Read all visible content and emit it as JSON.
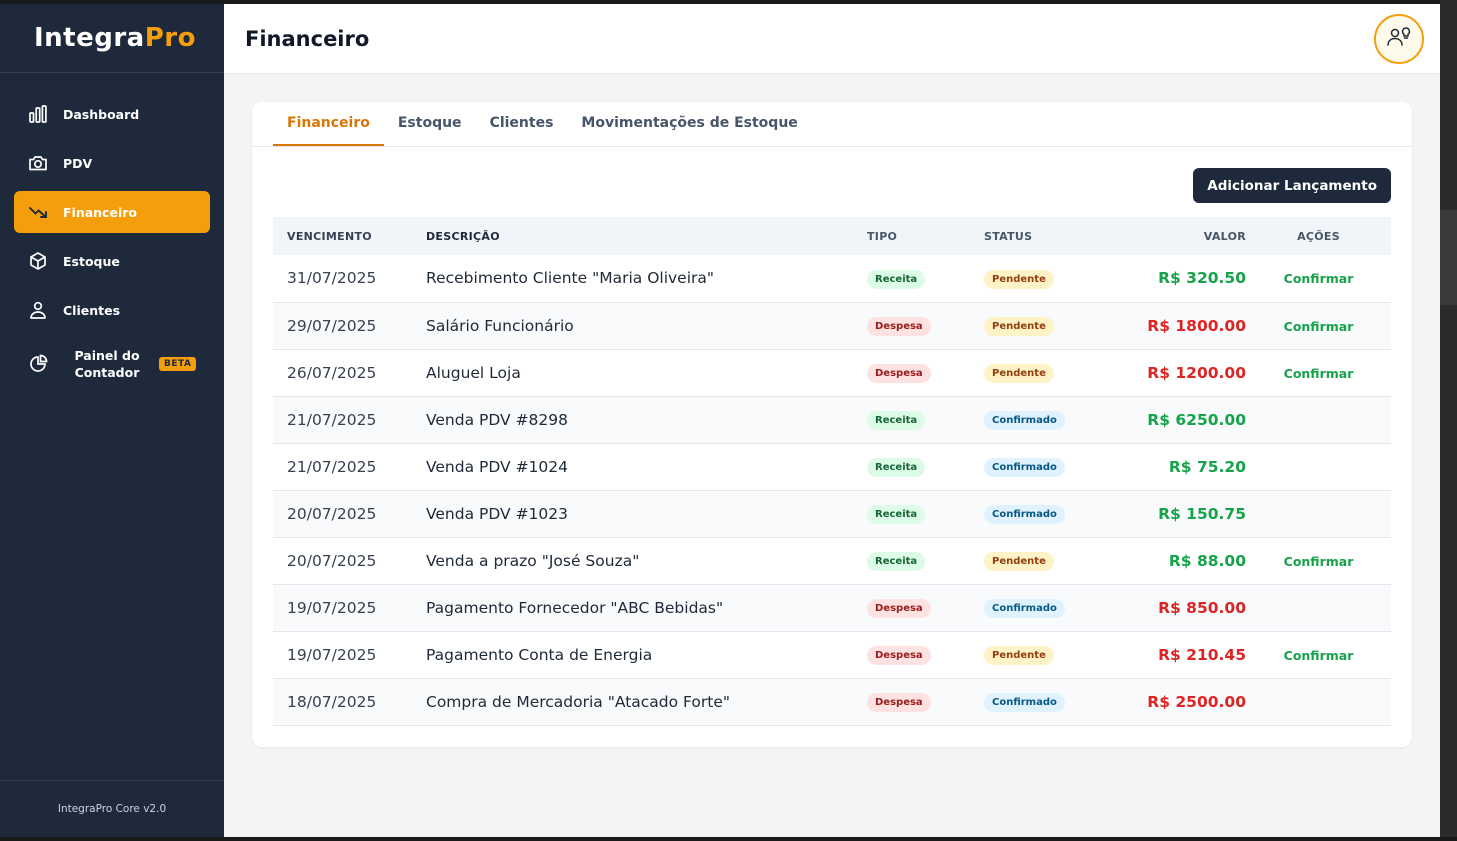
{
  "brand": {
    "part1": "Integra",
    "part2": "Pro"
  },
  "sidebar": {
    "items": [
      {
        "label": "Dashboard",
        "icon": "bar-chart-icon"
      },
      {
        "label": "PDV",
        "icon": "camera-icon"
      },
      {
        "label": "Financeiro",
        "icon": "trend-down-icon",
        "active": true
      },
      {
        "label": "Estoque",
        "icon": "box-icon"
      },
      {
        "label": "Clientes",
        "icon": "user-icon"
      },
      {
        "label": "Painel do Contador",
        "icon": "pie-chart-icon",
        "badge": "BETA"
      }
    ],
    "footer": "IntegraPro Core v2.0"
  },
  "header": {
    "title": "Financeiro",
    "avatar_icon": "user-bulb-icon"
  },
  "tabs": [
    "Financeiro",
    "Estoque",
    "Clientes",
    "Movimentações de Estoque"
  ],
  "actions": {
    "add_label": "Adicionar Lançamento"
  },
  "table": {
    "headers": {
      "date": "VENCIMENTO",
      "desc": "DESCRIÇÃO",
      "tipo": "TIPO",
      "status": "STATUS",
      "valor": "VALOR",
      "acoes": "AÇÕES"
    },
    "rows": [
      {
        "date": "31/07/2025",
        "desc": "Recebimento Cliente \"Maria Oliveira\"",
        "tipo": "Receita",
        "status": "Pendente",
        "valor": "R$ 320.50",
        "acao": "Confirmar"
      },
      {
        "date": "29/07/2025",
        "desc": "Salário Funcionário",
        "tipo": "Despesa",
        "status": "Pendente",
        "valor": "R$ 1800.00",
        "acao": "Confirmar"
      },
      {
        "date": "26/07/2025",
        "desc": "Aluguel Loja",
        "tipo": "Despesa",
        "status": "Pendente",
        "valor": "R$ 1200.00",
        "acao": "Confirmar"
      },
      {
        "date": "21/07/2025",
        "desc": "Venda PDV #8298",
        "tipo": "Receita",
        "status": "Confirmado",
        "valor": "R$ 6250.00",
        "acao": ""
      },
      {
        "date": "21/07/2025",
        "desc": "Venda PDV #1024",
        "tipo": "Receita",
        "status": "Confirmado",
        "valor": "R$ 75.20",
        "acao": ""
      },
      {
        "date": "20/07/2025",
        "desc": "Venda PDV #1023",
        "tipo": "Receita",
        "status": "Confirmado",
        "valor": "R$ 150.75",
        "acao": ""
      },
      {
        "date": "20/07/2025",
        "desc": "Venda a prazo \"José Souza\"",
        "tipo": "Receita",
        "status": "Pendente",
        "valor": "R$ 88.00",
        "acao": "Confirmar"
      },
      {
        "date": "19/07/2025",
        "desc": "Pagamento Fornecedor \"ABC Bebidas\"",
        "tipo": "Despesa",
        "status": "Confirmado",
        "valor": "R$ 850.00",
        "acao": ""
      },
      {
        "date": "19/07/2025",
        "desc": "Pagamento Conta de Energia",
        "tipo": "Despesa",
        "status": "Pendente",
        "valor": "R$ 210.45",
        "acao": "Confirmar"
      },
      {
        "date": "18/07/2025",
        "desc": "Compra de Mercadoria \"Atacado Forte\"",
        "tipo": "Despesa",
        "status": "Confirmado",
        "valor": "R$ 2500.00",
        "acao": ""
      }
    ]
  },
  "colors": {
    "sidebar_bg": "#1e293b",
    "accent": "#f59e0b",
    "positive": "#16a34a",
    "negative": "#dc2626"
  }
}
